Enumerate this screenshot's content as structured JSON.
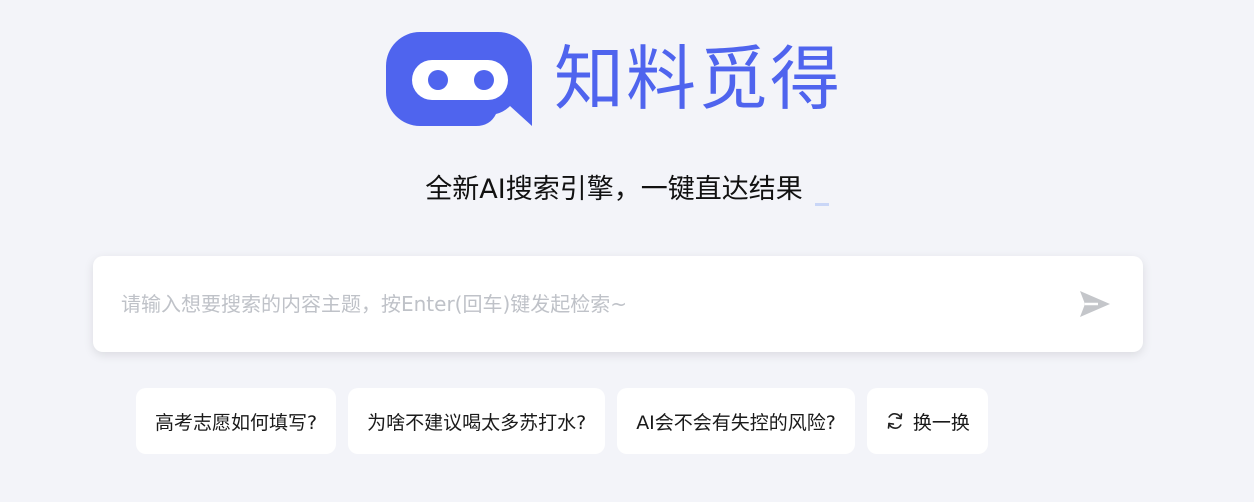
{
  "brand": {
    "name": "知料觅得",
    "color": "#4f64ee"
  },
  "tagline": "全新AI搜索引擎，一键直达结果",
  "search": {
    "placeholder": "请输入想要搜索的内容主题，按Enter(回车)键发起检索~",
    "value": "",
    "send_icon": "send-icon"
  },
  "suggestions": [
    {
      "label": "高考志愿如何填写?"
    },
    {
      "label": "为啥不建议喝太多苏打水?"
    },
    {
      "label": "AI会不会有失控的风险?"
    }
  ],
  "refresh": {
    "label": "换一换",
    "icon": "refresh-icon"
  }
}
